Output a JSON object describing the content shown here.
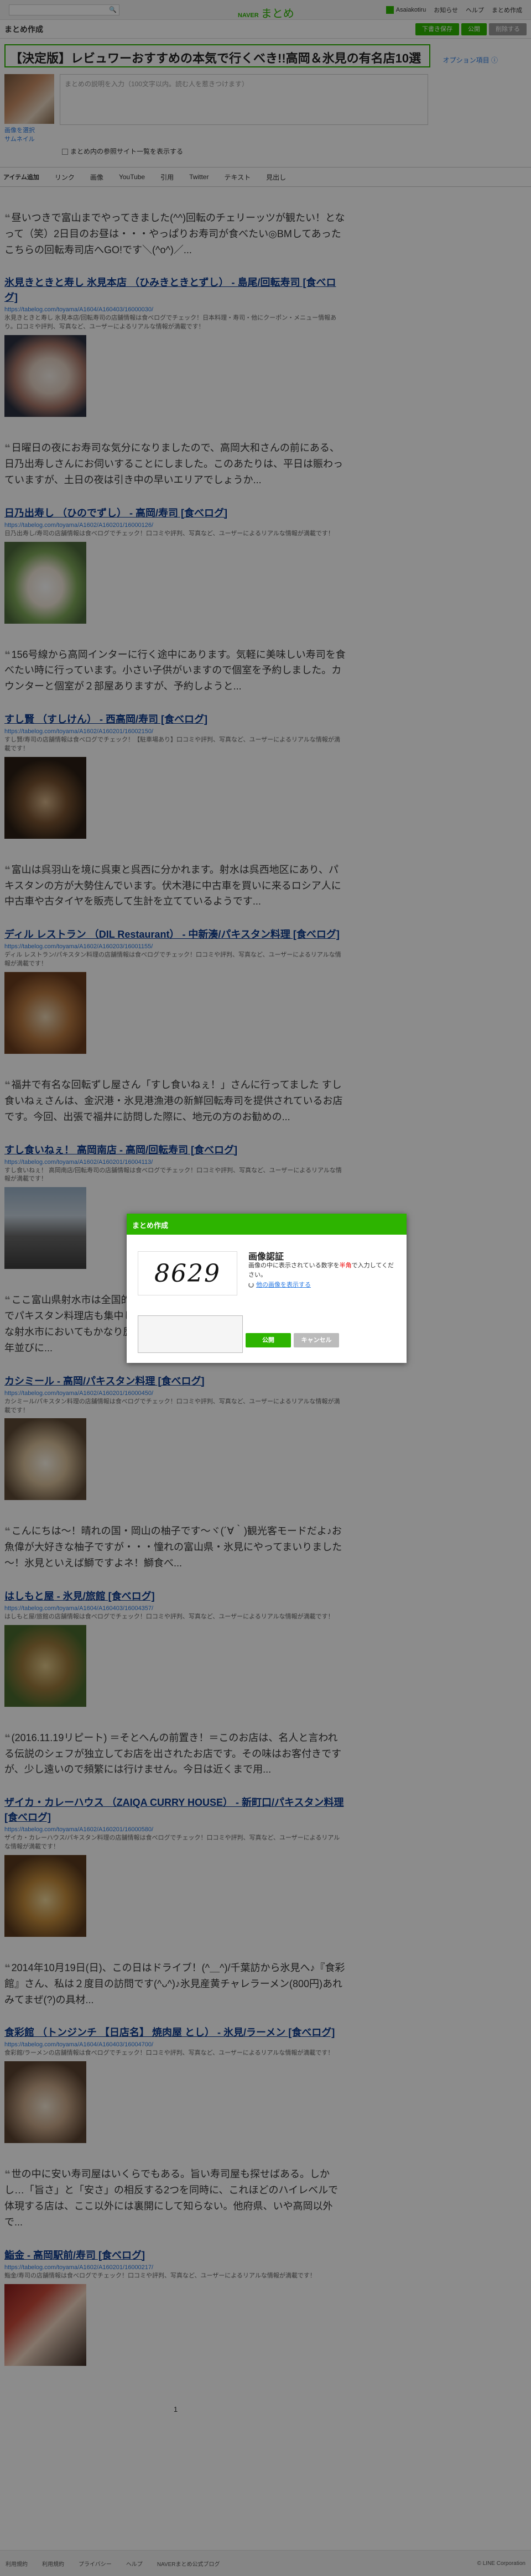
{
  "global_header": {
    "search_icon": "search-icon",
    "logo_naver": "NAVER",
    "logo_matome": "まとめ",
    "username": "Asaiakotiru",
    "links": [
      "お知らせ",
      "ヘルプ",
      "まとめ作成"
    ]
  },
  "editor": {
    "title": "まとめ作成",
    "buttons": [
      "下書き保存",
      "公開",
      "削除する"
    ]
  },
  "title_input": {
    "value": "【決定版】レビュワーおすすめの本気で行くべき!!高岡＆氷見の有名店10選",
    "option_link": "オプション項目 ⓘ"
  },
  "description": {
    "thumbnail_change": "画像を選択\nサムネイル",
    "placeholder": "まとめの説明を入力（100文字以内。読む人を惹きつけます）",
    "ref_checkbox": "まとめ内の参照サイト一覧を表示する"
  },
  "toolbar": {
    "items": [
      "アイテム追加",
      "リンク",
      "画像",
      "YouTube",
      "引用",
      "Twitter",
      "テキスト",
      "見出し"
    ]
  },
  "items": [
    {
      "quote": "昼いつきで富山までやってきました(^^)回転のチェリーッツが観たい！となって（笑）2日目のお昼は・・・やっぱりお寿司が食べたい◎BMしてあったこちらの回転寿司店へGO!です＼(^o^)／...",
      "title": "氷見きときと寿し 氷見本店 （ひみきときとずし） - 島尾/回転寿司 [食べログ]",
      "url": "https://tabelog.com/toyama/A1604/A160403/16000030/",
      "desc": "氷見きときと寿し 氷見本店/回転寿司の店舗情報は食べログでチェック！日本料理・寿司・他にクーポン・メニュー情報あり。口コミや評判、写真など、ユーザーによるリアルな情報が満載です！"
    },
    {
      "quote": "日曜日の夜にお寿司な気分になりましたので、高岡大和さんの前にある、日乃出寿しさんにお伺いすることにしました。このあたりは、平日は賑わっていますが、土日の夜は引き中の早いエリアでしょうか...",
      "title": "日乃出寿し （ひのでずし） - 高岡/寿司 [食べログ]",
      "url": "https://tabelog.com/toyama/A1602/A160201/16000126/",
      "desc": "日乃出寿し/寿司の店舗情報は食べログでチェック！口コミや評判、写真など、ユーザーによるリアルな情報が満載です！"
    },
    {
      "quote": "156号線から高岡インターに行く途中にあります。気軽に美味しい寿司を食べたい時に行っています。小さい子供がいますので個室を予約しました。カウンターと個室が２部屋ありますが、予約しようと...",
      "title": "すし賢 （すしけん） - 西高岡/寿司 [食べログ]",
      "url": "https://tabelog.com/toyama/A1602/A160201/16002150/",
      "desc": "すし賢/寿司の店舗情報は食べログでチェック！【駐車場あり】口コミや評判、写真など、ユーザーによるリアルな情報が満載です！"
    },
    {
      "quote": "富山は呉羽山を境に呉東と呉西に分かれます。射水は呉西地区にあり、パキスタンの方が大勢住んでいます。伏木港に中古車を買いに来るロシア人に中古車や古タイヤを販売して生計を立てているようです...",
      "title": "ディル レストラン （DIL Restaurant） - 中新湊/パキスタン料理 [食べログ]",
      "url": "https://tabelog.com/toyama/A1602/A160203/16001155/",
      "desc": "ディル レストラン/パキスタン料理の店舗情報は食べログでチェック！口コミや評判、写真など、ユーザーによるリアルな情報が満載です！"
    },
    {
      "quote": "福井で有名な回転ずし屋さん「すし食いねぇ！」さんに行ってました すし食いねぇさんは、金沢港・氷見港漁港の新鮮回転寿司を提供されているお店です。今回、出張で福井に訪問した際に、地元の方のお勧めの...",
      "title": "すし食いねぇ！ 高岡南店 - 高岡/回転寿司 [食べログ]",
      "url": "https://tabelog.com/toyama/A1602/A160201/16004113/",
      "desc": "すし食いねぇ！ 高岡南店/回転寿司の店舗情報は食べログでチェック！口コミや評判、写真など、ユーザーによるリアルな情報が満載です！"
    },
    {
      "quote": "ここ富山県射水市は全国的に見ても比較的パキスタン人が多い地域のようでパキスタン料理店も集中しているのだ。そしてここ「カシミール」はそんな射水市においてもかなり歴史のあるパキスタン料理ホット・スプーンは昨年並びに...",
      "title": "カシミール - 高岡/パキスタン料理 [食べログ]",
      "url": "https://tabelog.com/toyama/A1602/A160201/16000450/",
      "desc": "カシミール/パキスタン料理の店舗情報は食べログでチェック！口コミや評判、写真など、ユーザーによるリアルな情報が満載です！"
    },
    {
      "quote": "こんにちは～！晴れの国・岡山の柚子です～ヾ(´∀｀)観光客モードだよ♪お魚偉が大好きな柚子ですが・・・憧れの富山県・氷見にやってまいりました～！氷見といえば鰤ですよネ！鰤食べ...",
      "title": "はしもと屋 - 氷見/旅館 [食べログ]",
      "url": "https://tabelog.com/toyama/A1604/A160403/16004357/",
      "desc": "はしもと屋/旅館の店舗情報は食べログでチェック！口コミや評判、写真など、ユーザーによるリアルな情報が満載です！"
    },
    {
      "quote": "(2016.11.19リピート) ＝そとへんの前置き！＝このお店は、名人と言われる伝説のシェフが独立してお店を出されたお店です。その味はお客付きですが、少し遠いので頻繁には行けません。今日は近くまで用...",
      "title": "ザイカ・カレーハウス （ZAIQA CURRY HOUSE） - 新町口/パキスタン料理 [食べログ]",
      "url": "https://tabelog.com/toyama/A1602/A160201/16000580/",
      "desc": "ザイカ・カレーハウス/パキスタン料理の店舗情報は食べログでチェック！口コミや評判、写真など、ユーザーによるリアルな情報が満載です！"
    },
    {
      "quote": "2014年10月19日(日)、この日はドライブ！(^＿^)/千葉訪から氷見へ♪『食彩館』さん、私は２度目の訪問です(^ᴗ^)♪氷見産黄チャレラーメン(800円)あれみてまぜ(?)の具材...",
      "title": "食彩館 （トンジンチ 【日店名】 焼肉屋 とし） - 氷見/ラーメン [食べログ]",
      "url": "https://tabelog.com/toyama/A1604/A160403/16004700/",
      "desc": "食彩館/ラーメンの店舗情報は食べログでチェック！口コミや評判、写真など、ユーザーによるリアルな情報が満載です！"
    },
    {
      "quote": "世の中に安い寿司屋はいくらでもある。旨い寿司屋も探せばある。しかし…「旨さ」と「安さ」の相反する2つを同時に、これほどのハイレベルで体現する店は、ここ以外には裏開にして知らない。他府県、いや高岡以外で...",
      "title": "鮨金 - 高岡駅前/寿司 [食べログ]",
      "url": "https://tabelog.com/toyama/A1602/A160201/16000217/",
      "desc": "鮨金/寿司の店舗情報は食べログでチェック！口コミや評判、写真など、ユーザーによるリアルな情報が満載です！"
    }
  ],
  "pagination": {
    "current": "1"
  },
  "footer": {
    "links": [
      "利用規約",
      "利用規約",
      "プライバシー",
      "ヘルプ",
      "NAVERまとめ公式ブログ"
    ],
    "copyright": "© LINE Corporation"
  },
  "captcha": {
    "header": "まとめ作成",
    "image_text": "8629",
    "title": "画像認証",
    "desc_before": "画像の中に表示されている数字を",
    "desc_red": "半角",
    "desc_after": "で入力してください。",
    "refresh": "他の画像を表示する",
    "ok": "公開",
    "cancel": "キャンセル"
  },
  "colors": {
    "accent": "#2db400",
    "link": "#0c3a8c"
  }
}
